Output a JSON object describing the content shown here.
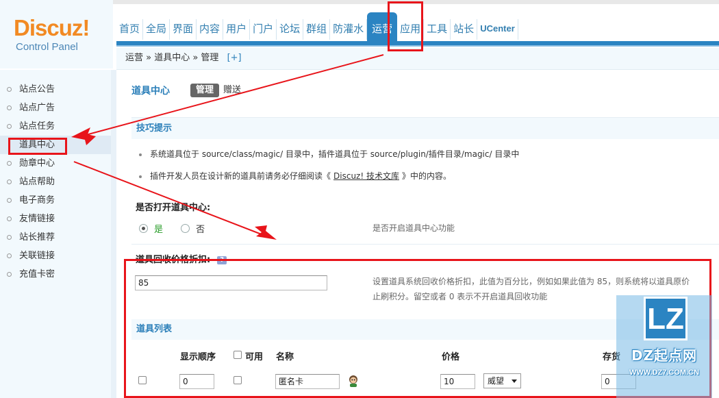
{
  "logo": {
    "brand": "Discuz",
    "brand_suffix": "!",
    "subtitle": "Control Panel"
  },
  "nav": {
    "items": [
      "首页",
      "全局",
      "界面",
      "内容",
      "用户",
      "门户",
      "论坛",
      "群组",
      "防灌水",
      "运营",
      "应用",
      "工具",
      "站长",
      "UCenter"
    ],
    "active": "运营"
  },
  "breadcrumb": {
    "path": "运营 » 道具中心 » 管理",
    "toggle": "[+]"
  },
  "sidebar": {
    "items": [
      {
        "label": "站点公告"
      },
      {
        "label": "站点广告"
      },
      {
        "label": "站点任务"
      },
      {
        "label": "道具中心",
        "active": true
      },
      {
        "label": "勋章中心"
      },
      {
        "label": "站点帮助"
      },
      {
        "label": "电子商务"
      },
      {
        "label": "友情链接"
      },
      {
        "label": "站长推荐"
      },
      {
        "label": "关联链接"
      },
      {
        "label": "充值卡密"
      }
    ]
  },
  "main": {
    "title": "道具中心",
    "tabs": [
      {
        "label": "管理",
        "active": true
      },
      {
        "label": "赠送",
        "active": false
      }
    ],
    "tips": {
      "heading": "技巧提示",
      "line1": "系统道具位于 source/class/magic/ 目录中，插件道具位于 source/plugin/插件目录/magic/ 目录中",
      "line2_before": "插件开发人员在设计新的道具前请务必仔细阅读《",
      "line2_link": "Discuz! 技术文库",
      "line2_after": "》中的内容。"
    },
    "open_setting": {
      "label": "是否打开道具中心:",
      "yes": "是",
      "no": "否",
      "selected": "yes",
      "description": "是否开启道具中心功能"
    },
    "discount_setting": {
      "label": "道具回收价格折扣:",
      "help": "?",
      "value": "85",
      "description_line1": "设置道具系统回收价格折扣，此值为百分比，例如如果此值为 85，则系统将以道具原价",
      "description_line2": "止刷积分。留空或者 0 表示不开启道具回收功能"
    },
    "list": {
      "heading": "道具列表",
      "columns": {
        "order": "显示顺序",
        "available": "可用",
        "name": "名称",
        "price": "价格",
        "stock": "存货"
      },
      "rows": [
        {
          "order": "0",
          "name": "匿名卡",
          "price": "10",
          "currency": "威望",
          "stock": "0"
        }
      ]
    }
  },
  "watermark": {
    "logo_text": "LZ",
    "brand": "DZ起点网",
    "site": "WWW.DZ7.COM.CN"
  },
  "colors": {
    "accent": "#2b84c2",
    "link": "#2b7fb9",
    "logo": "#f28a23",
    "annotation": "#e8141a"
  }
}
